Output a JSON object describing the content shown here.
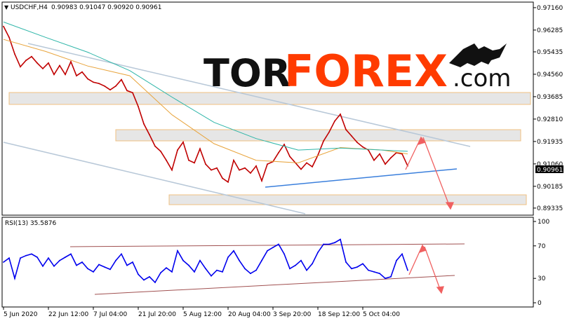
{
  "chart_data": [
    {
      "type": "line",
      "header": {
        "symbol": "USDCHF,H4",
        "ohlc": "0.90983 0.91047 0.90920 0.90961"
      },
      "current_price_label": "0.90961",
      "y_ticks": [
        "0.97160",
        "0.96285",
        "0.95435",
        "0.94560",
        "0.93685",
        "0.92810",
        "0.91935",
        "0.91060",
        "0.90185",
        "0.89335"
      ],
      "y_tick_values": [
        0.9716,
        0.96285,
        0.95435,
        0.9456,
        0.93685,
        0.9281,
        0.91935,
        0.9106,
        0.90185,
        0.89335
      ],
      "ylim": [
        0.8925,
        0.9724
      ],
      "x_ticks": [
        "5 Jun 2020",
        "22 Jun 12:00",
        "7 Jul 04:00",
        "21 Jul 20:00",
        "5 Aug 12:00",
        "20 Aug 04:00",
        "3 Sep 20:00",
        "18 Sep 12:00",
        "5 Oct 04:00"
      ],
      "series": [
        {
          "name": "",
          "color": "#c00000",
          "x": [
            0,
            8,
            16,
            24,
            32,
            40,
            48,
            56,
            64,
            72,
            80,
            88,
            96,
            104,
            112,
            120,
            128,
            136,
            144,
            152,
            160,
            168,
            176,
            184,
            192,
            200,
            208,
            216,
            224,
            232,
            240,
            248,
            256,
            264,
            272,
            280,
            288,
            296,
            304,
            312,
            320,
            328,
            336,
            344,
            352,
            360,
            368,
            376,
            384,
            392,
            400,
            408,
            416,
            424,
            432,
            440,
            448,
            456,
            464,
            472,
            480,
            488,
            496,
            504,
            512,
            520,
            528,
            536,
            544,
            552,
            560,
            568,
            576
          ],
          "values": [
            0.9643,
            0.96,
            0.9535,
            0.9485,
            0.951,
            0.9525,
            0.95,
            0.9478,
            0.95,
            0.9455,
            0.949,
            0.9455,
            0.9505,
            0.945,
            0.9465,
            0.9438,
            0.9425,
            0.942,
            0.941,
            0.9395,
            0.941,
            0.9435,
            0.9392,
            0.9384,
            0.933,
            0.9262,
            0.922,
            0.9175,
            0.9155,
            0.912,
            0.9082,
            0.916,
            0.9191,
            0.912,
            0.911,
            0.9165,
            0.9105,
            0.9082,
            0.909,
            0.905,
            0.9035,
            0.912,
            0.9082,
            0.909,
            0.907,
            0.9098,
            0.904,
            0.9105,
            0.9115,
            0.915,
            0.9182,
            0.9135,
            0.911,
            0.9085,
            0.911,
            0.9095,
            0.914,
            0.9195,
            0.923,
            0.9273,
            0.93,
            0.924,
            0.9215,
            0.919,
            0.9172,
            0.916,
            0.912,
            0.9145,
            0.9105,
            0.913,
            0.915,
            0.9145,
            0.9098
          ]
        },
        {
          "name": "",
          "color": "#e8a43c",
          "x": [
            0,
            60,
            120,
            180,
            240,
            300,
            360,
            420,
            480,
            540,
            576
          ],
          "values": [
            0.9592,
            0.9545,
            0.9488,
            0.945,
            0.9298,
            0.9185,
            0.912,
            0.911,
            0.917,
            0.916,
            0.9145
          ]
        },
        {
          "name": "",
          "color": "#2db5a8",
          "x": [
            0,
            60,
            120,
            180,
            240,
            300,
            360,
            420,
            480,
            540,
            576
          ],
          "values": [
            0.966,
            0.96,
            0.9542,
            0.947,
            0.9367,
            0.9268,
            0.9205,
            0.916,
            0.9168,
            0.916,
            0.9155
          ]
        }
      ]
    },
    {
      "type": "line",
      "header": "RSI(13) 35.5876",
      "y_ticks": [
        "100",
        "70",
        "30",
        "0"
      ],
      "y_tick_values": [
        100,
        70,
        30,
        0
      ],
      "ylim": [
        0,
        100
      ],
      "series": [
        {
          "name": "",
          "color": "#0000ee",
          "x": [
            0,
            8,
            16,
            24,
            32,
            40,
            48,
            56,
            64,
            72,
            80,
            88,
            96,
            104,
            112,
            120,
            128,
            136,
            144,
            152,
            160,
            168,
            176,
            184,
            192,
            200,
            208,
            216,
            224,
            232,
            240,
            248,
            256,
            264,
            272,
            280,
            288,
            296,
            304,
            312,
            320,
            328,
            336,
            344,
            352,
            360,
            368,
            376,
            384,
            392,
            400,
            408,
            416,
            424,
            432,
            440,
            448,
            456,
            464,
            472,
            480,
            488,
            496,
            504,
            512,
            520,
            528,
            536,
            544,
            552,
            560,
            568,
            576
          ],
          "values": [
            50,
            55,
            30,
            55,
            58,
            60,
            56,
            45,
            55,
            45,
            52,
            56,
            60,
            46,
            50,
            42,
            38,
            47,
            44,
            41,
            52,
            60,
            46,
            50,
            35,
            28,
            32,
            25,
            37,
            43,
            38,
            64,
            52,
            46,
            38,
            52,
            42,
            33,
            40,
            38,
            56,
            64,
            52,
            42,
            36,
            40,
            52,
            64,
            68,
            72,
            60,
            42,
            46,
            52,
            40,
            48,
            62,
            72,
            72,
            74,
            78,
            50,
            42,
            44,
            48,
            40,
            38,
            36,
            30,
            32,
            52,
            60,
            40
          ]
        }
      ]
    }
  ],
  "logo": {
    "brand_dark": "TOR",
    "brand_accent": "FOREX",
    "suffix": ".com"
  },
  "colors": {
    "price": "#c00000",
    "ma_fast": "#e8a43c",
    "ma_slow": "#2db5a8",
    "rsi": "#0000ee",
    "arrow": "#f06060",
    "zone_fill": "#e8e8e8",
    "zone_border": "#f0c080",
    "channel_line": "#b8c8d8",
    "support_line": "#3a7fdc",
    "rsi_channel": "#a05050"
  }
}
